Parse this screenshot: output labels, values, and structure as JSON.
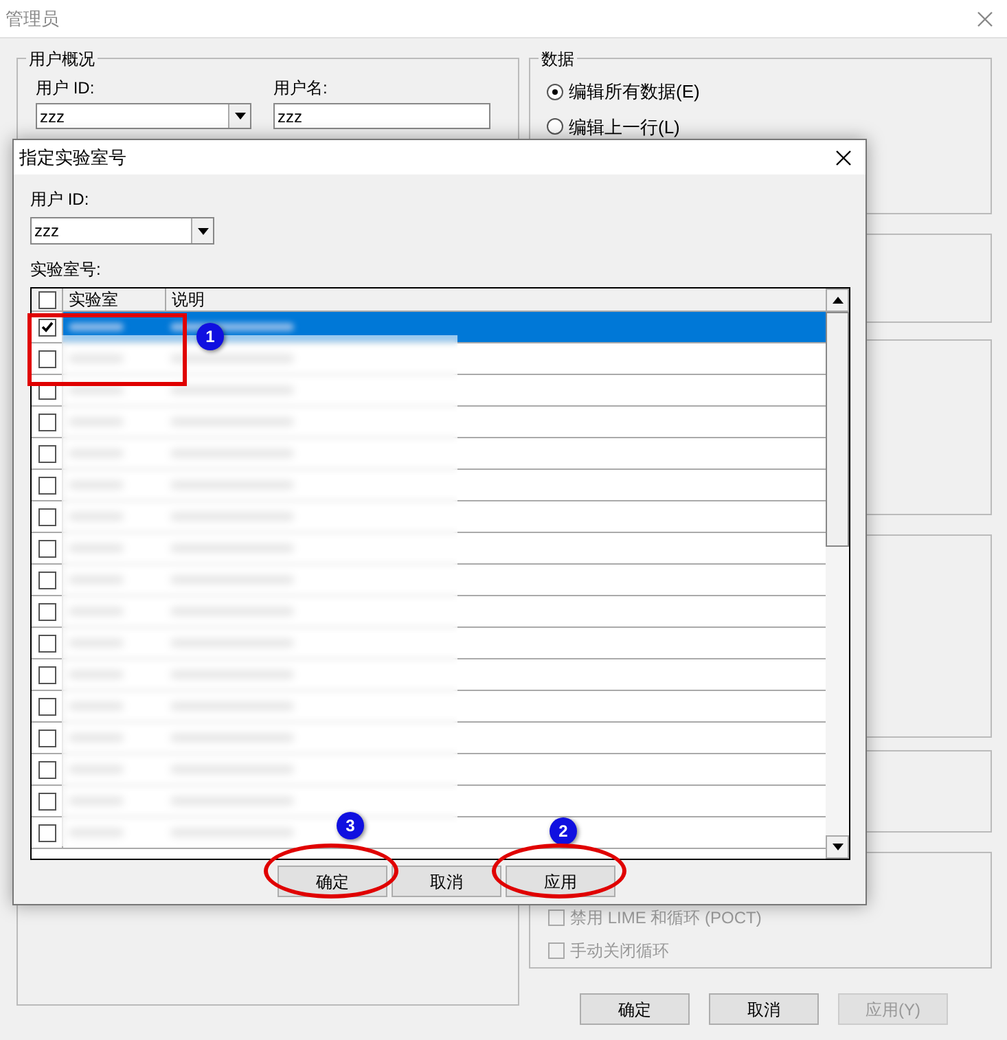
{
  "window": {
    "title": "管理员"
  },
  "user_group": {
    "title": "用户概况",
    "user_id_label": "用户 ID:",
    "user_id_value": "zzz",
    "username_label": "用户名:",
    "username_value": "zzz"
  },
  "data_group": {
    "title": "数据",
    "options": [
      {
        "label": "编辑所有数据(E)",
        "selected": true
      },
      {
        "label": "编辑上一行(L)",
        "selected": false
      }
    ]
  },
  "loop_options": [
    {
      "label": "禁用 LIME 和循环 (POCT)",
      "checked": false,
      "disabled": true
    },
    {
      "label": "手动关闭循环",
      "checked": false,
      "disabled": true
    }
  ],
  "buttons": [
    {
      "label": "确定",
      "disabled": false
    },
    {
      "label": "取消",
      "disabled": false
    },
    {
      "label": "应用(Y)",
      "disabled": true
    }
  ],
  "dialog": {
    "title": "指定实验室号",
    "user_id_label": "用户 ID:",
    "user_id_value": "zzz",
    "list_label": "实验室号:",
    "columns": [
      "实验室",
      "说明"
    ],
    "header_checked": false,
    "rows": [
      {
        "checked": true,
        "selected": true
      },
      {
        "checked": false,
        "selected": false
      },
      {
        "checked": false,
        "selected": false
      },
      {
        "checked": false,
        "selected": false
      },
      {
        "checked": false,
        "selected": false
      },
      {
        "checked": false,
        "selected": false
      },
      {
        "checked": false,
        "selected": false
      },
      {
        "checked": false,
        "selected": false
      },
      {
        "checked": false,
        "selected": false
      },
      {
        "checked": false,
        "selected": false
      },
      {
        "checked": false,
        "selected": false
      },
      {
        "checked": false,
        "selected": false
      },
      {
        "checked": false,
        "selected": false
      },
      {
        "checked": false,
        "selected": false
      },
      {
        "checked": false,
        "selected": false
      },
      {
        "checked": false,
        "selected": false
      },
      {
        "checked": false,
        "selected": false
      }
    ],
    "buttons": [
      {
        "label": "确定",
        "callout": "3"
      },
      {
        "label": "取消"
      },
      {
        "label": "应用",
        "callout": "2"
      }
    ],
    "row_callout": "1"
  }
}
